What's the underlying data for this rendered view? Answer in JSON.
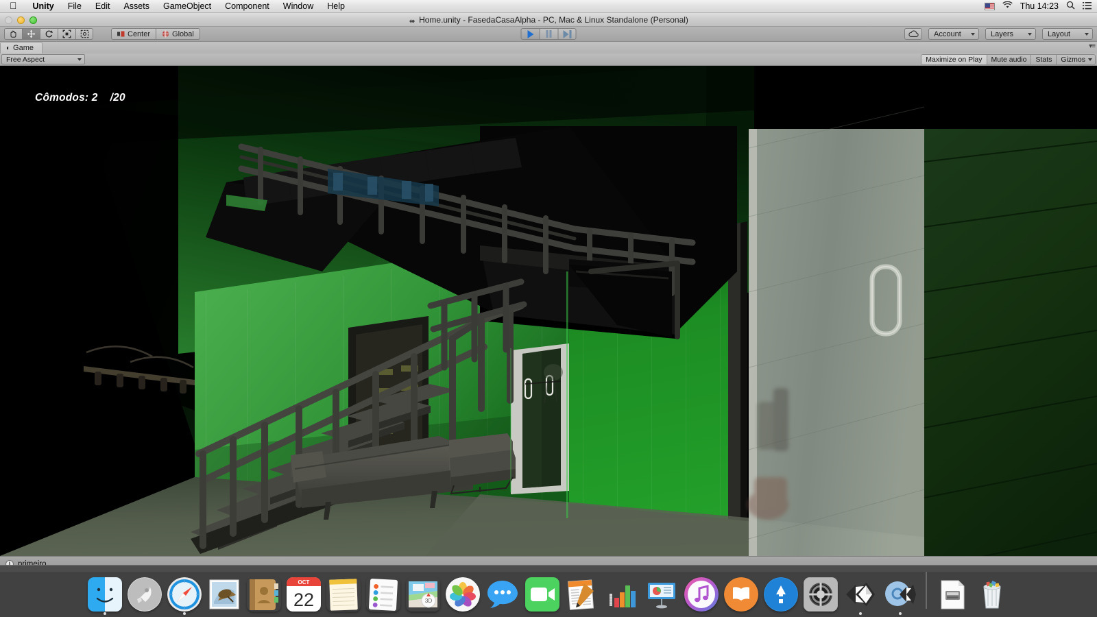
{
  "menubar": {
    "apple_icon": "apple-logo",
    "items": [
      {
        "label": "Unity",
        "bold": true
      },
      {
        "label": "File",
        "bold": false
      },
      {
        "label": "Edit",
        "bold": false
      },
      {
        "label": "Assets",
        "bold": false
      },
      {
        "label": "GameObject",
        "bold": false
      },
      {
        "label": "Component",
        "bold": false
      },
      {
        "label": "Window",
        "bold": false
      },
      {
        "label": "Help",
        "bold": false
      }
    ],
    "status_items": {
      "input_flag": "us-flag-icon",
      "wifi": "wifi-icon",
      "clock": "Thu 14:23",
      "search": "search-icon",
      "notifications": "list-icon"
    }
  },
  "window": {
    "title": "Home.unity - FasedaCasaAlpha - PC, Mac & Linux Standalone (Personal)",
    "title_icon": "unity-icon"
  },
  "toolbar": {
    "transform_tools": [
      {
        "name": "hand-tool",
        "glyph": "✋",
        "active": false
      },
      {
        "name": "move-tool",
        "glyph": "✥",
        "active": true
      },
      {
        "name": "rotate-tool",
        "glyph": "↻",
        "active": false
      },
      {
        "name": "scale-tool",
        "glyph": "⛶",
        "active": false
      },
      {
        "name": "rect-tool",
        "glyph": "▣",
        "active": false
      }
    ],
    "pivot_label": "Center",
    "handle_label": "Global",
    "play_label": "play-button",
    "pause_label": "pause-button",
    "step_label": "step-button",
    "cloud_label": "collab-cloud-button",
    "account_label": "Account",
    "layers_label": "Layers",
    "layout_label": "Layout"
  },
  "gameview": {
    "tab_label": "Game",
    "tab_icon": "game-tab-icon",
    "aspect_value": "Free Aspect",
    "maximize_label": "Maximize on Play",
    "mute_label": "Mute audio",
    "stats_label": "Stats",
    "gizmos_label": "Gizmos",
    "hud_text": "Cômodos: 2    /20",
    "hud_counter": "2",
    "hud_max": "/20",
    "hud_label": "Cômodos:"
  },
  "scene": {
    "description": "3D architectural interior: green painted walls, dark steel staircase with railings, sofa and armchair, glass sliding door at right",
    "wall_green_lit": "#35a03a",
    "wall_green_mid": "#2e8f33",
    "wall_green_dark": "#113f15",
    "wall_green_deep": "#0a2c0d",
    "floor_color": "#57604f",
    "metal_dark": "#3a3a38",
    "metal_mid": "#4d4d4a",
    "glass_color": "#8b958a",
    "black": "#000000",
    "door_frame_gray": "#c5c5c0",
    "sofa_color": "#4a4a46"
  },
  "statusbar": {
    "message": "primeiro",
    "icon": "warning-icon"
  },
  "dock": {
    "items": [
      {
        "name": "finder",
        "label": "Finder",
        "running": true
      },
      {
        "name": "launchpad",
        "label": "Launchpad",
        "running": false
      },
      {
        "name": "safari",
        "label": "Safari",
        "running": true
      },
      {
        "name": "mail",
        "label": "Mail",
        "running": false
      },
      {
        "name": "contacts",
        "label": "Contacts",
        "running": false
      },
      {
        "name": "calendar",
        "label": "Calendar",
        "running": false,
        "badge_month": "OCT",
        "badge_day": "22"
      },
      {
        "name": "notes",
        "label": "Notes",
        "running": false
      },
      {
        "name": "reminders",
        "label": "Reminders",
        "running": false
      },
      {
        "name": "maps",
        "label": "Maps",
        "running": false
      },
      {
        "name": "photos",
        "label": "Photos",
        "running": false
      },
      {
        "name": "messages",
        "label": "Messages",
        "running": false
      },
      {
        "name": "facetime",
        "label": "FaceTime",
        "running": false
      },
      {
        "name": "pages",
        "label": "Pages",
        "running": false
      },
      {
        "name": "numbers",
        "label": "Numbers",
        "running": false
      },
      {
        "name": "keynote",
        "label": "Keynote",
        "running": false
      },
      {
        "name": "itunes",
        "label": "iTunes",
        "running": false
      },
      {
        "name": "ibooks",
        "label": "iBooks",
        "running": false
      },
      {
        "name": "appstore",
        "label": "App Store",
        "running": false
      },
      {
        "name": "system-preferences",
        "label": "System Preferences",
        "running": false
      },
      {
        "name": "unity",
        "label": "Unity",
        "running": true
      },
      {
        "name": "monodevelop",
        "label": "MonoDevelop-Unity",
        "running": true
      }
    ],
    "trailing_items": [
      {
        "name": "document-stack",
        "label": "Downloads"
      },
      {
        "name": "trash",
        "label": "Trash"
      }
    ]
  }
}
